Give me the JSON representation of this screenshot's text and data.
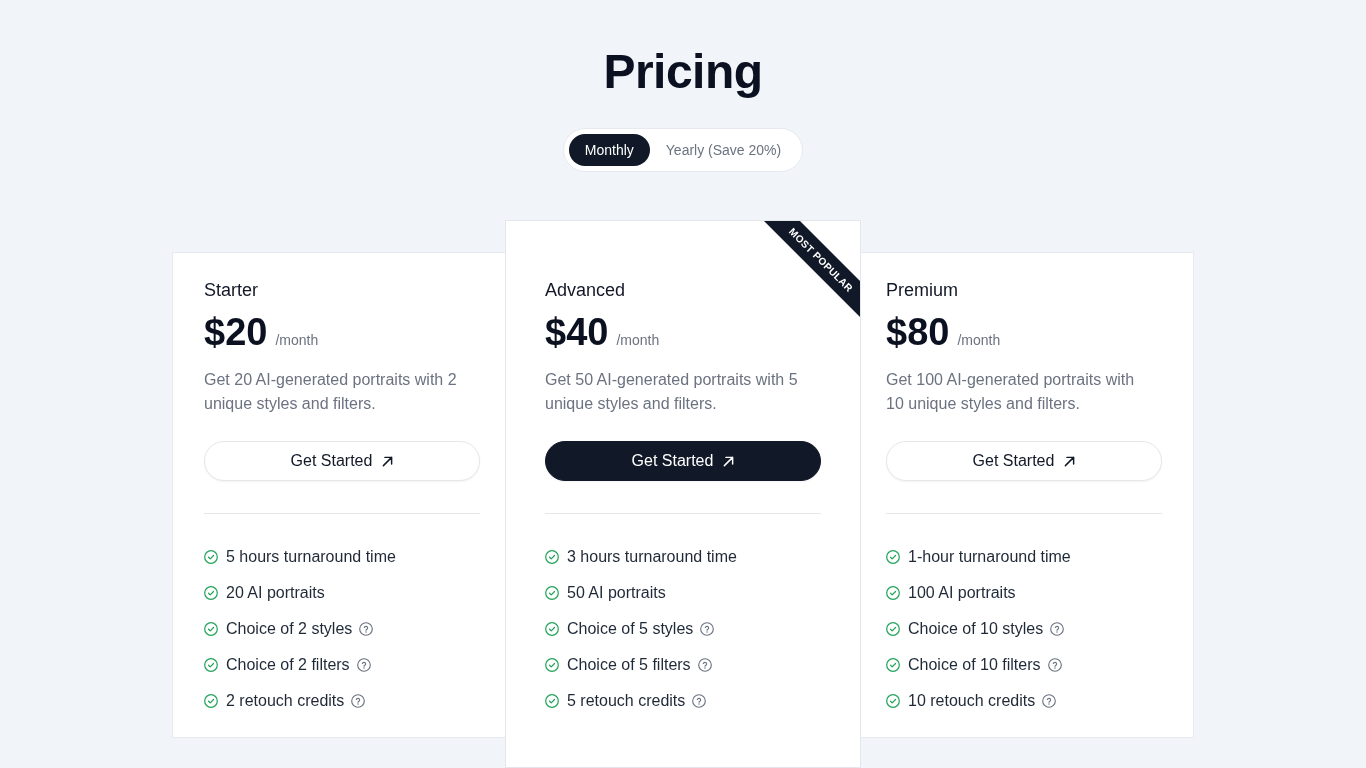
{
  "title": "Pricing",
  "billing_toggle": [
    {
      "label": "Monthly",
      "selected": true
    },
    {
      "label": "Yearly (Save 20%)",
      "selected": false
    }
  ],
  "plans": [
    {
      "name": "Starter",
      "price": "$20",
      "period": "/month",
      "description": "Get 20 AI-generated portraits with 2 unique styles and filters.",
      "button": "Get Started",
      "featured": false,
      "features": [
        {
          "text": "5 hours turnaround time",
          "info": false
        },
        {
          "text": "20 AI portraits",
          "info": false
        },
        {
          "text": "Choice of 2 styles",
          "info": true
        },
        {
          "text": "Choice of 2 filters",
          "info": true
        },
        {
          "text": "2 retouch credits",
          "info": true
        }
      ]
    },
    {
      "name": "Advanced",
      "price": "$40",
      "period": "/month",
      "description": "Get 50 AI-generated portraits with 5 unique styles and filters.",
      "button": "Get Started",
      "featured": true,
      "ribbon": "MOST POPULAR",
      "features": [
        {
          "text": "3 hours turnaround time",
          "info": false
        },
        {
          "text": "50 AI portraits",
          "info": false
        },
        {
          "text": "Choice of 5 styles",
          "info": true
        },
        {
          "text": "Choice of 5 filters",
          "info": true
        },
        {
          "text": "5 retouch credits",
          "info": true
        }
      ]
    },
    {
      "name": "Premium",
      "price": "$80",
      "period": "/month",
      "description": "Get 100 AI-generated portraits with 10 unique styles and filters.",
      "button": "Get Started",
      "featured": false,
      "features": [
        {
          "text": "1-hour turnaround time",
          "info": false
        },
        {
          "text": "100 AI portraits",
          "info": false
        },
        {
          "text": "Choice of 10 styles",
          "info": true
        },
        {
          "text": "Choice of 10 filters",
          "info": true
        },
        {
          "text": "10 retouch credits",
          "info": true
        }
      ]
    }
  ]
}
